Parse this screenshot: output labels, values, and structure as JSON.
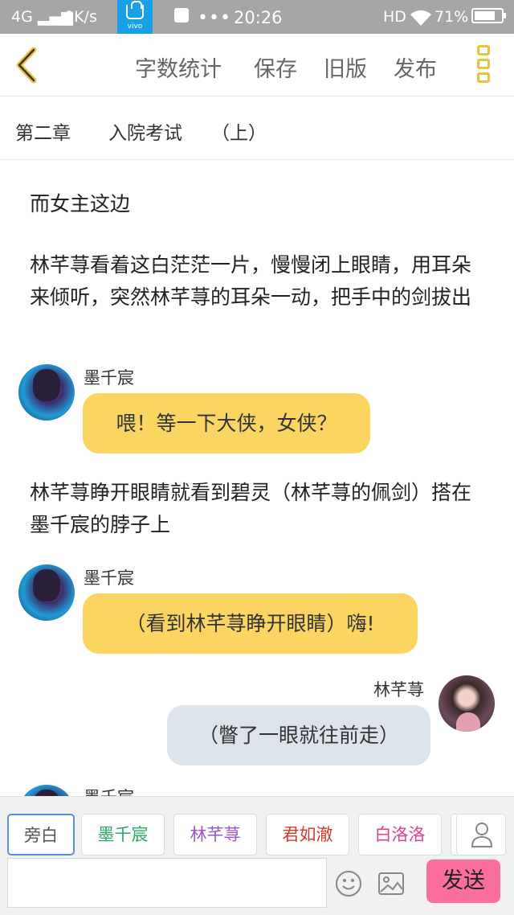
{
  "status_bar": {
    "network": "4G",
    "speed": "0K/s",
    "app_badge_label": "vivo",
    "dots": "•••",
    "time": "20:26",
    "hd": "HD",
    "battery": "71%"
  },
  "toolbar": {
    "word_count": "字数统计",
    "save": "保存",
    "old_version": "旧版",
    "publish": "发布"
  },
  "chapter": {
    "number": "第二章",
    "name": "入院考试",
    "part": "（上）"
  },
  "messages": [
    {
      "type": "narration",
      "text": "而女主这边"
    },
    {
      "type": "narration",
      "text": "林芊荨看着这白茫茫一片，慢慢闭上眼睛，用耳朵来倾听，突然林芊荨的耳朵一动，把手中的剑拔出"
    },
    {
      "type": "dialogue",
      "speaker": "墨千宸",
      "text": "喂！等一下大侠，女侠？"
    },
    {
      "type": "narration",
      "text": "林芊荨睁开眼睛就看到碧灵（林芊荨的佩剑）搭在墨千宸的脖子上"
    },
    {
      "type": "dialogue",
      "speaker": "墨千宸",
      "text": "（看到林芊荨睁开眼睛）嗨!"
    },
    {
      "type": "dialogue",
      "speaker": "林芊荨",
      "text": "（瞥了一眼就往前走）"
    },
    {
      "type": "dialogue",
      "speaker": "墨千宸",
      "text": ""
    }
  ],
  "roles": {
    "aside": "旁白",
    "items": [
      "墨千宸",
      "林芊荨",
      "君如澈",
      "白洛洛"
    ]
  },
  "composer": {
    "input_value": "",
    "send": "发送"
  },
  "colors": {
    "accent_yellow": "#fbd561",
    "bubble_grey": "#dde3ea",
    "send_pink": "#fb6ea0",
    "menu_yellow": "#e8c43a"
  }
}
